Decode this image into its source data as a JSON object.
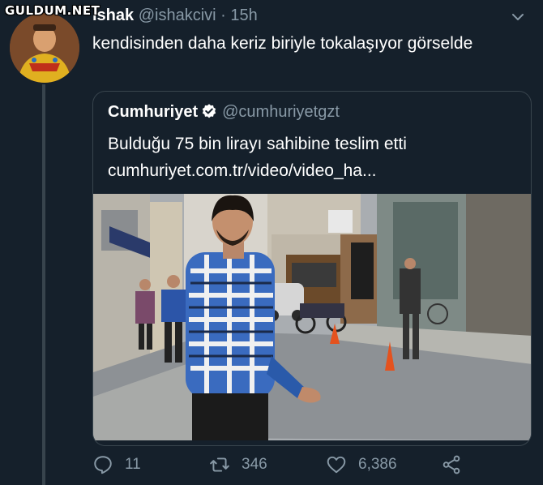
{
  "watermark": "GULDUM.NET",
  "tweet": {
    "name": "ishak",
    "handle": "@ishakcivi",
    "dot": "·",
    "time": "15h",
    "text": "kendisinden daha keriz biriyle tokalaşıyor görselde"
  },
  "quoted": {
    "name": "Cumhuriyet",
    "handle": "@cumhuriyetgzt",
    "text_line1": "Bulduğu 75 bin lirayı sahibine teslim etti",
    "text_line2": "cumhuriyet.com.tr/video/video_ha..."
  },
  "actions": {
    "reply_count": "11",
    "retweet_count": "346",
    "like_count": "6,386"
  },
  "colors": {
    "background": "#15202b",
    "secondary_text": "#8899a6",
    "border": "#38444d",
    "verified": "#ffffff"
  },
  "icons": [
    "chevron-down-icon",
    "verified-icon",
    "reply-icon",
    "retweet-icon",
    "like-icon",
    "share-icon"
  ]
}
